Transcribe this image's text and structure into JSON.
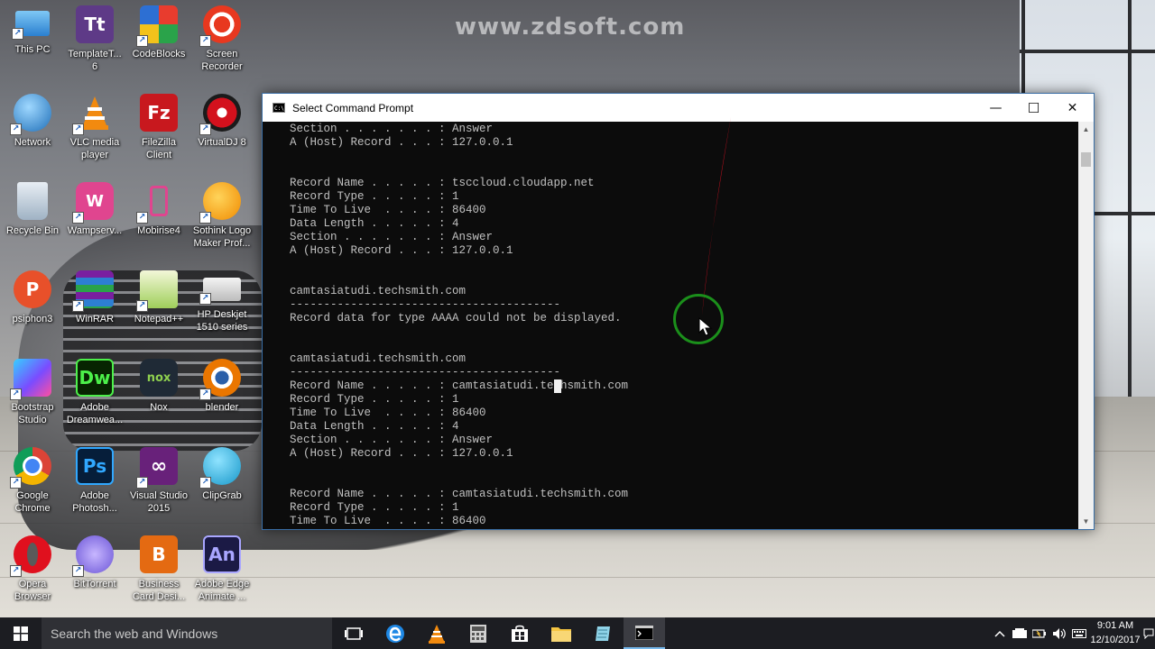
{
  "watermark": "www.zdsoft.com",
  "desktop_icons": [
    {
      "label": "This PC"
    },
    {
      "label": "TemplateT...\n6"
    },
    {
      "label": "CodeBlocks"
    },
    {
      "label": "Screen\nRecorder"
    },
    {
      "label": "Network"
    },
    {
      "label": "VLC media\nplayer"
    },
    {
      "label": "FileZilla\nClient"
    },
    {
      "label": "VirtualDJ 8"
    },
    {
      "label": "Recycle Bin"
    },
    {
      "label": "Wampserv..."
    },
    {
      "label": "Mobirise4"
    },
    {
      "label": "Sothink Logo\nMaker Prof..."
    },
    {
      "label": "psiphon3"
    },
    {
      "label": "WinRAR"
    },
    {
      "label": "Notepad++"
    },
    {
      "label": "HP Deskjet\n1510 series"
    },
    {
      "label": "Bootstrap\nStudio"
    },
    {
      "label": "Adobe\nDreamwea..."
    },
    {
      "label": "Nox"
    },
    {
      "label": "blender"
    },
    {
      "label": "Google\nChrome"
    },
    {
      "label": "Adobe\nPhotosh..."
    },
    {
      "label": "Visual Studio\n2015"
    },
    {
      "label": "ClipGrab"
    },
    {
      "label": "Opera\nBrowser"
    },
    {
      "label": "BitTorrent"
    },
    {
      "label": "Business\nCard Desi..."
    },
    {
      "label": "Adobe Edge\nAnimate ..."
    }
  ],
  "icon_glyphs": {
    "templatetoaster": "Tt",
    "filezilla": "Fz",
    "psiphon": "P",
    "dreamweaver": "Dw",
    "nox": "nox",
    "photoshop": "Ps",
    "business_card": "B",
    "edge_animate": "An"
  },
  "window": {
    "title": "Select Command Prompt",
    "app_icon_text": "C:\\",
    "minimize_glyph": "—",
    "maximize_glyph": "☐",
    "close_glyph": "✕"
  },
  "console": {
    "text": "Section . . . . . . . : Answer\nA (Host) Record . . . : 127.0.0.1\n\n\nRecord Name . . . . . : tsccloud.cloudapp.net\nRecord Type . . . . . : 1\nTime To Live  . . . . : 86400\nData Length . . . . . : 4\nSection . . . . . . . : Answer\nA (Host) Record . . . : 127.0.0.1\n\n\ncamtasiatudi.techsmith.com\n----------------------------------------\nRecord data for type AAAA could not be displayed.\n\n\ncamtasiatudi.techsmith.com\n----------------------------------------\nRecord Name . . . . . : camtasiatudi.techsmith.com\nRecord Type . . . . . : 1\nTime To Live  . . . . : 86400\nData Length . . . . . : 4\nSection . . . . . . . : Answer\nA (Host) Record . . . : 127.0.0.1\n\n\nRecord Name . . . . . : camtasiatudi.techsmith.com\nRecord Type . . . . . : 1\nTime To Live  . . . . : 86400"
  },
  "taskbar": {
    "search_placeholder": "Search the web and Windows",
    "pinned": [
      "task-view-icon",
      "edge-icon",
      "vlc-icon",
      "calculator-icon",
      "store-icon",
      "file-explorer-icon",
      "notepad-icon",
      "command-prompt-icon"
    ],
    "active_app": "command-prompt-icon",
    "clock_time": "9:01 AM",
    "clock_date": "12/10/2017"
  },
  "colors": {
    "console_bg": "#0c0c0c",
    "console_fg": "#c0c0c0",
    "taskbar_bg": "#1c1d22",
    "annotation_ring": "#1b8f1b",
    "annotation_stroke": "#d01020",
    "accent": "#76b9ed"
  }
}
